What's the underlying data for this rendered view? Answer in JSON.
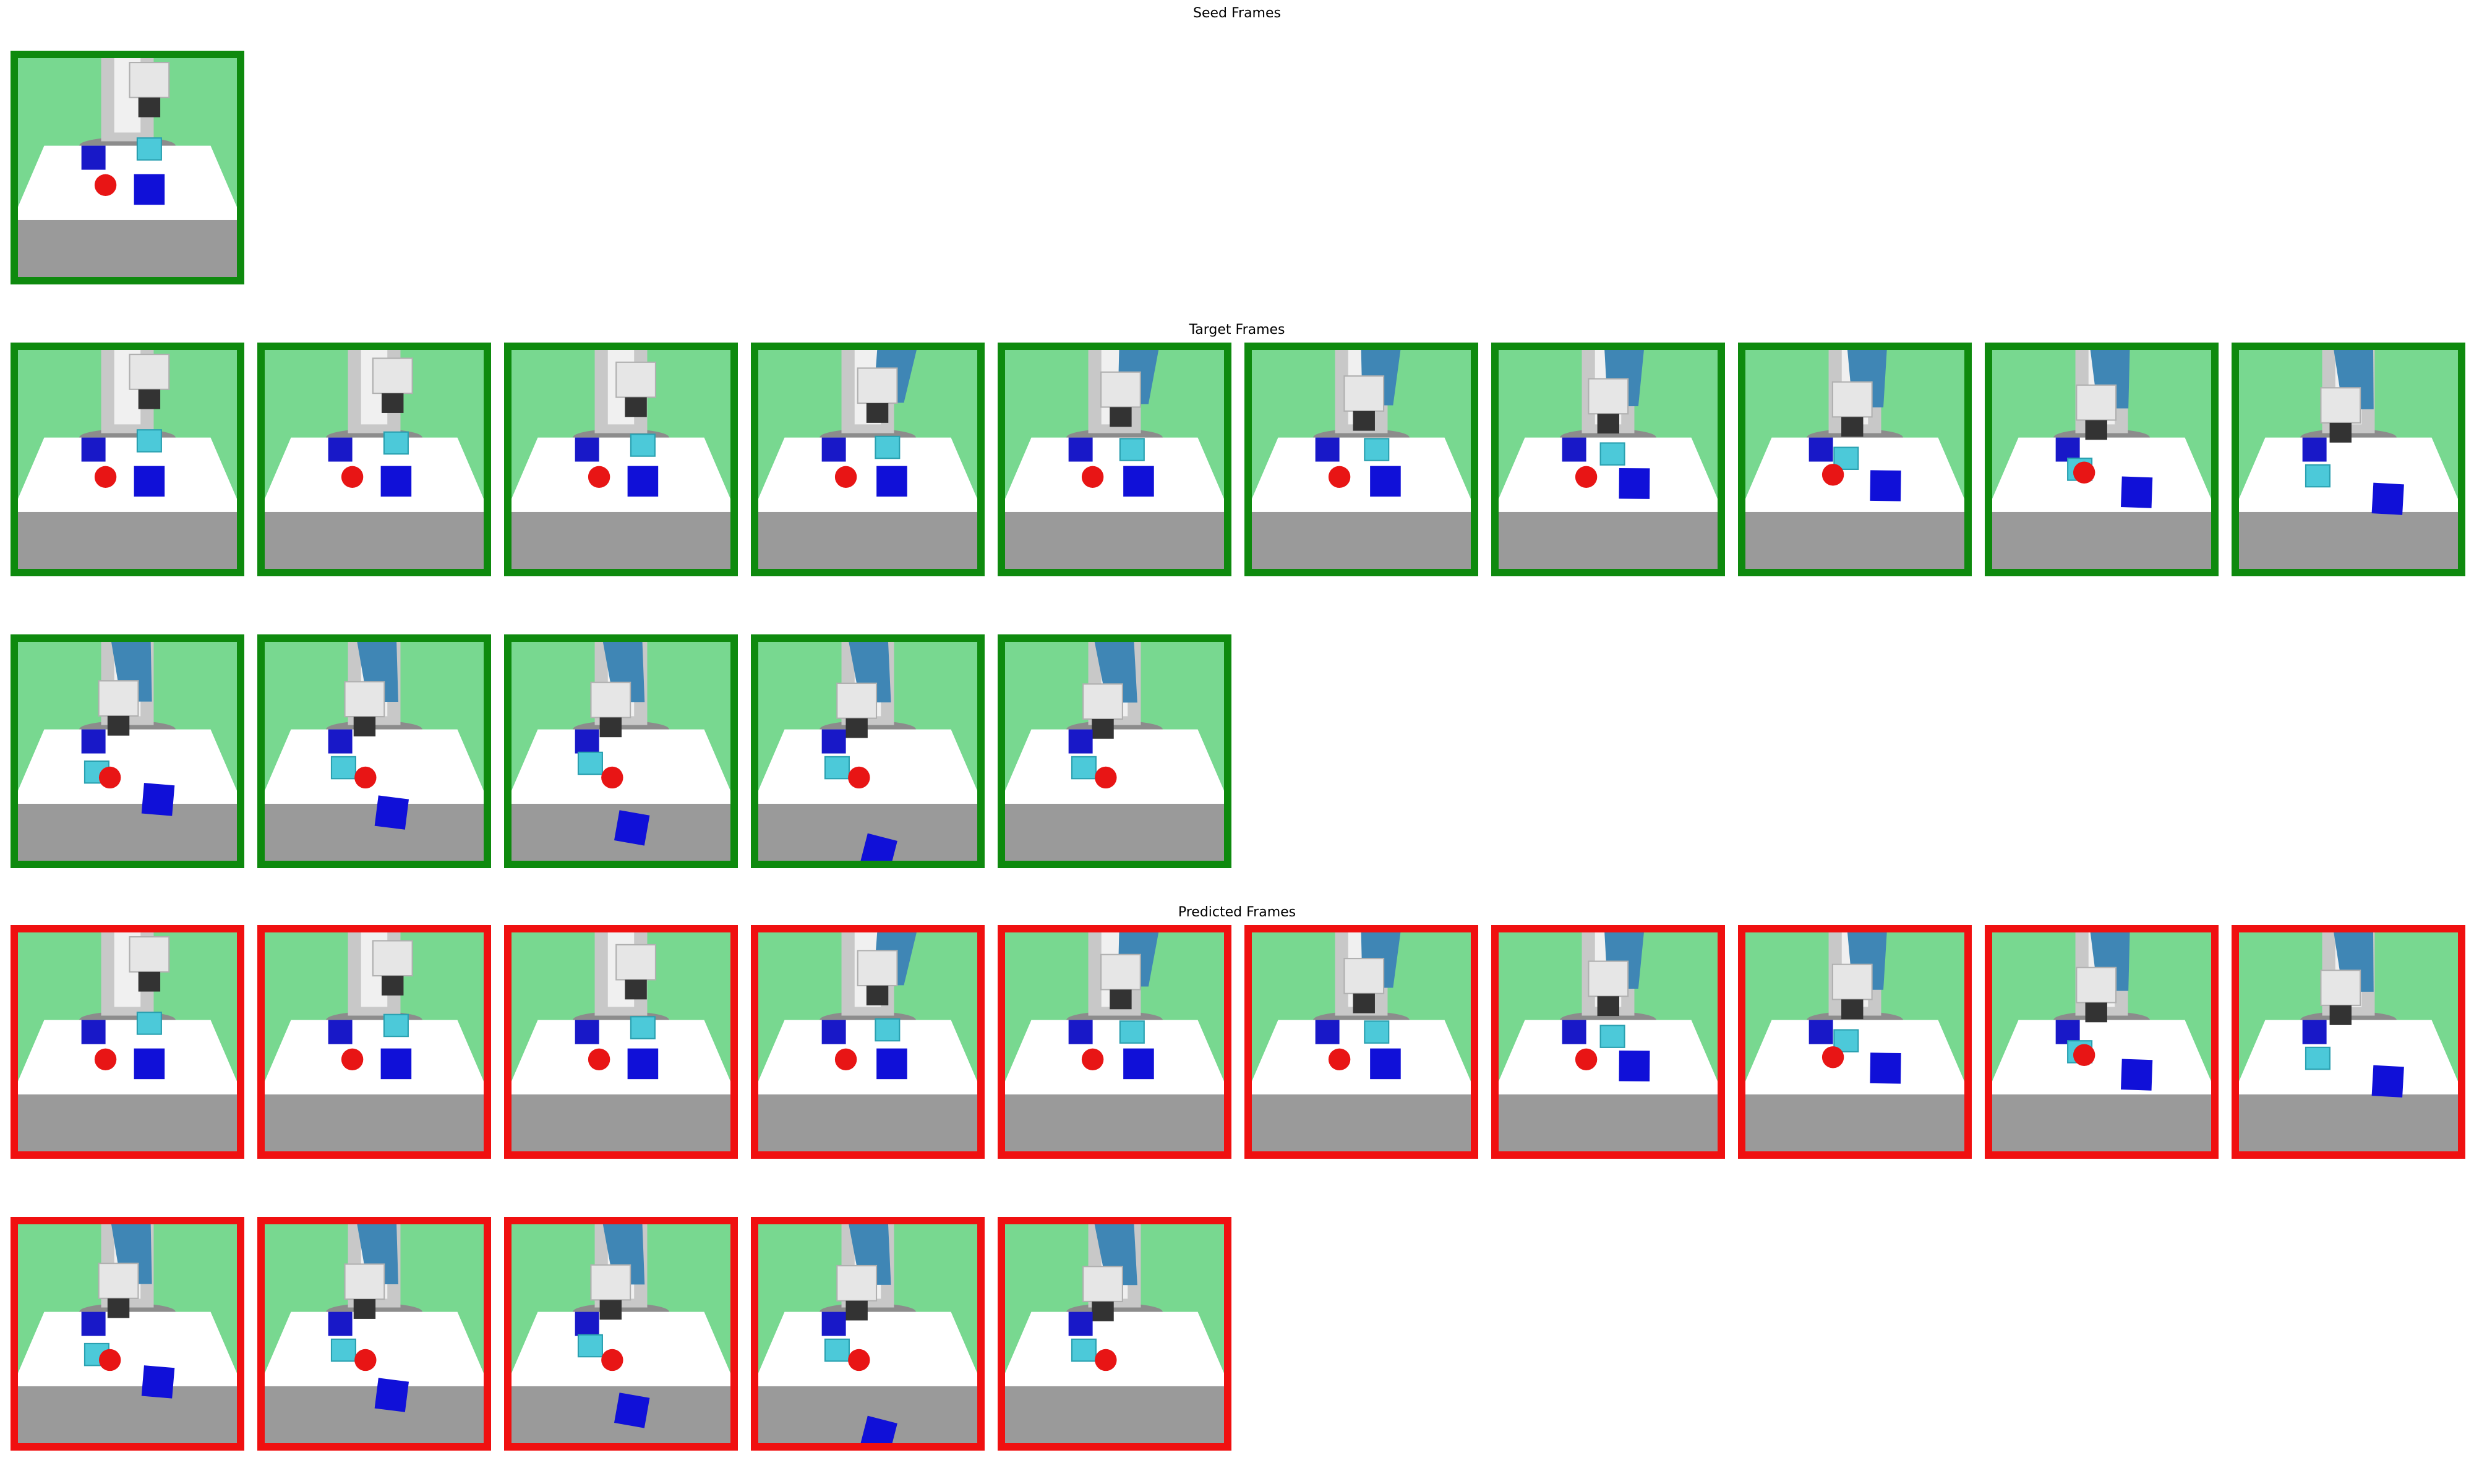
{
  "titles": {
    "seed": "Seed Frames",
    "target": "Target Frames",
    "predicted": "Predicted Frames"
  },
  "colors": {
    "seed_border": "#0e8a0e",
    "target_border": "#0e8a0e",
    "predicted_border": "#f01010",
    "wall": "#78d890",
    "table": "#ffffff",
    "floor": "#9a9a9a",
    "robot_white": "#e6e6e6",
    "robot_blue": "#3f86b5",
    "gripper": "#333333",
    "cube_blue": "#1010d8",
    "cube_cyan": "#4cc9d9",
    "ball_red": "#e81515"
  },
  "sections": [
    {
      "key": "seed",
      "rows": [
        {
          "count": 1
        }
      ]
    },
    {
      "key": "target",
      "rows": [
        {
          "count": 10
        },
        {
          "count": 5
        }
      ]
    },
    {
      "key": "predicted",
      "rows": [
        {
          "count": 10
        },
        {
          "count": 5
        }
      ]
    }
  ],
  "frames": [
    {
      "arm": 0.0,
      "blueCube": [
        0.6,
        0.6
      ],
      "cyanCube": [
        0.6,
        0.42
      ],
      "ball": [
        0.4,
        0.58
      ],
      "ballVisible": true
    },
    {
      "arm": 0.1,
      "blueCube": [
        0.6,
        0.6
      ],
      "cyanCube": [
        0.6,
        0.43
      ],
      "ball": [
        0.4,
        0.58
      ],
      "ballVisible": true
    },
    {
      "arm": 0.2,
      "blueCube": [
        0.6,
        0.6
      ],
      "cyanCube": [
        0.6,
        0.44
      ],
      "ball": [
        0.4,
        0.58
      ],
      "ballVisible": true
    },
    {
      "arm": 0.35,
      "blueCube": [
        0.61,
        0.6
      ],
      "cyanCube": [
        0.59,
        0.45
      ],
      "ball": [
        0.4,
        0.58
      ],
      "ballVisible": true
    },
    {
      "arm": 0.45,
      "blueCube": [
        0.61,
        0.6
      ],
      "cyanCube": [
        0.58,
        0.46
      ],
      "ball": [
        0.4,
        0.58
      ],
      "ballVisible": true
    },
    {
      "arm": 0.55,
      "blueCube": [
        0.61,
        0.6
      ],
      "cyanCube": [
        0.57,
        0.46
      ],
      "ball": [
        0.4,
        0.58
      ],
      "ballVisible": true
    },
    {
      "arm": 0.62,
      "blueCube": [
        0.62,
        0.61
      ],
      "cyanCube": [
        0.52,
        0.48
      ],
      "ball": [
        0.4,
        0.58
      ],
      "ballVisible": true
    },
    {
      "arm": 0.7,
      "blueCube": [
        0.64,
        0.62
      ],
      "cyanCube": [
        0.46,
        0.5
      ],
      "ball": [
        0.4,
        0.57
      ],
      "ballVisible": true
    },
    {
      "arm": 0.78,
      "blueCube": [
        0.66,
        0.65
      ],
      "cyanCube": [
        0.4,
        0.55
      ],
      "ball": [
        0.42,
        0.56
      ],
      "ballVisible": true
    },
    {
      "arm": 0.85,
      "blueCube": [
        0.68,
        0.68
      ],
      "cyanCube": [
        0.36,
        0.58
      ],
      "ball": [
        0.42,
        0.56
      ],
      "ballVisible": false
    },
    {
      "arm": 0.88,
      "blueCube": [
        0.64,
        0.72
      ],
      "cyanCube": [
        0.36,
        0.6
      ],
      "ball": [
        0.42,
        0.62
      ],
      "ballVisible": true
    },
    {
      "arm": 0.9,
      "blueCube": [
        0.58,
        0.78
      ],
      "cyanCube": [
        0.36,
        0.58
      ],
      "ball": [
        0.46,
        0.62
      ],
      "ballVisible": true
    },
    {
      "arm": 0.92,
      "blueCube": [
        0.55,
        0.85
      ],
      "cyanCube": [
        0.36,
        0.56
      ],
      "ball": [
        0.46,
        0.62
      ],
      "ballVisible": true
    },
    {
      "arm": 0.94,
      "blueCube": [
        0.55,
        0.96
      ],
      "cyanCube": [
        0.36,
        0.58
      ],
      "ball": [
        0.46,
        0.62
      ],
      "ballVisible": true
    },
    {
      "arm": 0.96,
      "blueCube": [
        0.55,
        1.1
      ],
      "cyanCube": [
        0.36,
        0.58
      ],
      "ball": [
        0.46,
        0.62
      ],
      "ballVisible": true
    }
  ]
}
